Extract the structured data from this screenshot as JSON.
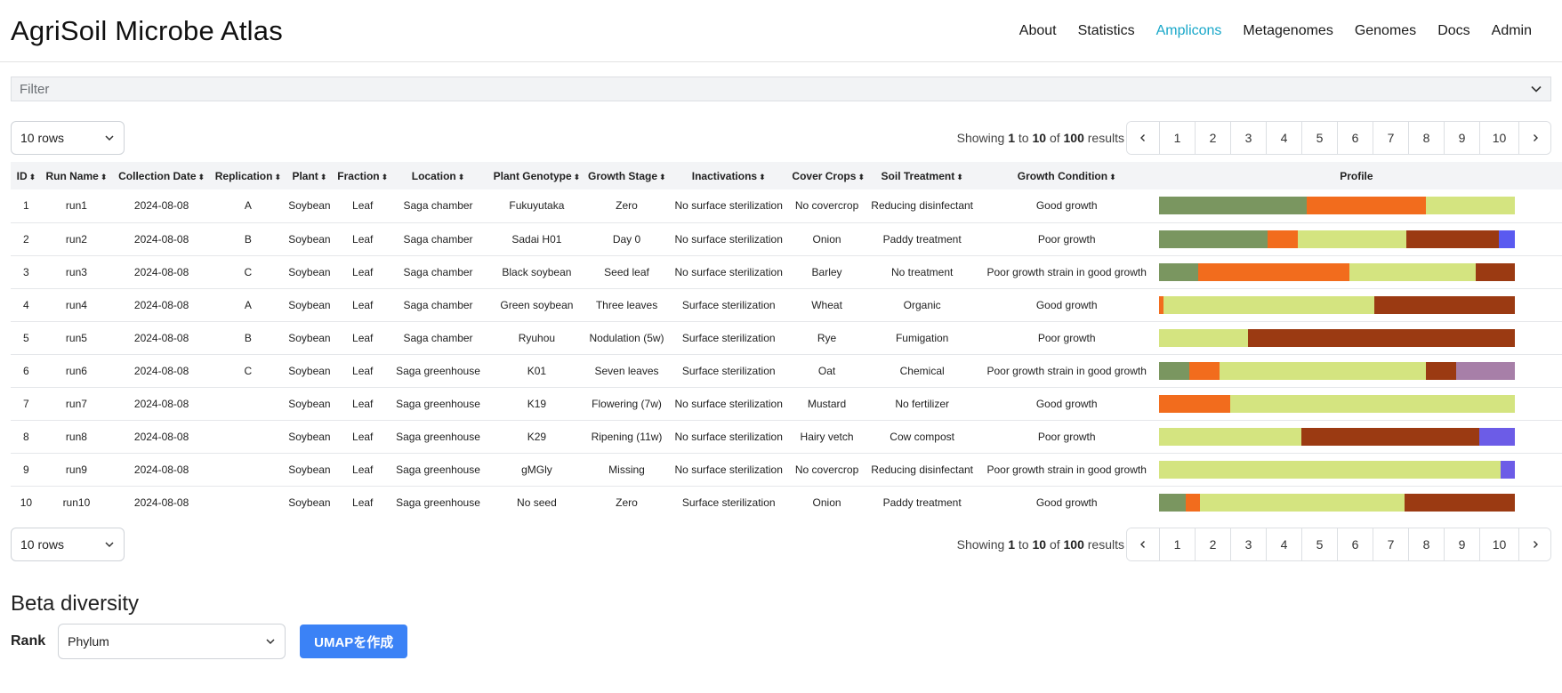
{
  "header": {
    "brand": "AgriSoil Microbe Atlas",
    "nav": [
      {
        "label": "About",
        "active": false
      },
      {
        "label": "Statistics",
        "active": false
      },
      {
        "label": "Amplicons",
        "active": true
      },
      {
        "label": "Metagenomes",
        "active": false
      },
      {
        "label": "Genomes",
        "active": false
      },
      {
        "label": "Docs",
        "active": false
      },
      {
        "label": "Admin",
        "active": false
      }
    ],
    "accent_color": "#18a7c9"
  },
  "filter": {
    "label": "Filter",
    "icon": "chevron-down-icon"
  },
  "pagination": {
    "rows_selected": "10 rows",
    "showing_prefix": "Showing",
    "from": "1",
    "to_word": "to",
    "to": "10",
    "of_word": "of",
    "total": "100",
    "results_word": "results",
    "pages": [
      "1",
      "2",
      "3",
      "4",
      "5",
      "6",
      "7",
      "8",
      "9",
      "10"
    ],
    "prev_icon": "chevron-left-icon",
    "next_icon": "chevron-right-icon"
  },
  "table": {
    "columns": [
      "ID",
      "Run Name",
      "Collection Date",
      "Replication",
      "Plant",
      "Fraction",
      "Location",
      "Plant Genotype",
      "Growth Stage",
      "Inactivations",
      "Cover Crops",
      "Soil Treatment",
      "Growth Condition",
      "Profile"
    ],
    "sortable": [
      true,
      true,
      true,
      true,
      true,
      true,
      true,
      true,
      true,
      true,
      true,
      true,
      true,
      false
    ],
    "profile_colors": {
      "c1": "#7a9660",
      "c2": "#f26c1d",
      "c3": "#d4e480",
      "c4": "#9b3a12",
      "c5": "#6c5ce7",
      "c6": "#a77fa8",
      "c7": "#5a5af0"
    },
    "rows": [
      {
        "id": "1",
        "run": "run1",
        "date": "2024-08-08",
        "rep": "A",
        "plant": "Soybean",
        "fraction": "Leaf",
        "location": "Saga chamber",
        "genotype": "Fukuyutaka",
        "stage": "Zero",
        "inact": "No surface sterilization",
        "cover": "No covercrop",
        "soil": "Reducing disinfectant",
        "growth": "Good growth",
        "profile": [
          {
            "color": "#7a9660",
            "frac": 0.415
          },
          {
            "color": "#f26c1d",
            "frac": 0.335
          },
          {
            "color": "#d4e480",
            "frac": 0.25
          }
        ]
      },
      {
        "id": "2",
        "run": "run2",
        "date": "2024-08-08",
        "rep": "B",
        "plant": "Soybean",
        "fraction": "Leaf",
        "location": "Saga chamber",
        "genotype": "Sadai H01",
        "stage": "Day 0",
        "inact": "No surface sterilization",
        "cover": "Onion",
        "soil": "Paddy treatment",
        "growth": "Poor growth",
        "profile": [
          {
            "color": "#7a9660",
            "frac": 0.305
          },
          {
            "color": "#f26c1d",
            "frac": 0.085
          },
          {
            "color": "#d4e480",
            "frac": 0.305
          },
          {
            "color": "#9b3a12",
            "frac": 0.26
          },
          {
            "color": "#5a5af0",
            "frac": 0.045
          }
        ]
      },
      {
        "id": "3",
        "run": "run3",
        "date": "2024-08-08",
        "rep": "C",
        "plant": "Soybean",
        "fraction": "Leaf",
        "location": "Saga chamber",
        "genotype": "Black soybean",
        "stage": "Seed leaf",
        "inact": "No surface sterilization",
        "cover": "Barley",
        "soil": "No treatment",
        "growth": "Poor growth strain in good growth",
        "profile": [
          {
            "color": "#7a9660",
            "frac": 0.11
          },
          {
            "color": "#f26c1d",
            "frac": 0.425
          },
          {
            "color": "#d4e480",
            "frac": 0.355
          },
          {
            "color": "#9b3a12",
            "frac": 0.11
          }
        ]
      },
      {
        "id": "4",
        "run": "run4",
        "date": "2024-08-08",
        "rep": "A",
        "plant": "Soybean",
        "fraction": "Leaf",
        "location": "Saga chamber",
        "genotype": "Green soybean",
        "stage": "Three leaves",
        "inact": "Surface sterilization",
        "cover": "Wheat",
        "soil": "Organic",
        "growth": "Good growth",
        "profile": [
          {
            "color": "#f26c1d",
            "frac": 0.012
          },
          {
            "color": "#d4e480",
            "frac": 0.593
          },
          {
            "color": "#9b3a12",
            "frac": 0.395
          }
        ]
      },
      {
        "id": "5",
        "run": "run5",
        "date": "2024-08-08",
        "rep": "B",
        "plant": "Soybean",
        "fraction": "Leaf",
        "location": "Saga chamber",
        "genotype": "Ryuhou",
        "stage": "Nodulation (5w)",
        "inact": "Surface sterilization",
        "cover": "Rye",
        "soil": "Fumigation",
        "growth": "Poor growth",
        "profile": [
          {
            "color": "#d4e480",
            "frac": 0.25
          },
          {
            "color": "#9b3a12",
            "frac": 0.75
          }
        ]
      },
      {
        "id": "6",
        "run": "run6",
        "date": "2024-08-08",
        "rep": "C",
        "plant": "Soybean",
        "fraction": "Leaf",
        "location": "Saga greenhouse",
        "genotype": "K01",
        "stage": "Seven leaves",
        "inact": "Surface sterilization",
        "cover": "Oat",
        "soil": "Chemical",
        "growth": "Poor growth strain in good growth",
        "profile": [
          {
            "color": "#7a9660",
            "frac": 0.085
          },
          {
            "color": "#f26c1d",
            "frac": 0.085
          },
          {
            "color": "#d4e480",
            "frac": 0.58
          },
          {
            "color": "#9b3a12",
            "frac": 0.085
          },
          {
            "color": "#a77fa8",
            "frac": 0.165
          }
        ]
      },
      {
        "id": "7",
        "run": "run7",
        "date": "2024-08-08",
        "rep": "",
        "plant": "Soybean",
        "fraction": "Leaf",
        "location": "Saga greenhouse",
        "genotype": "K19",
        "stage": "Flowering (7w)",
        "inact": "No surface sterilization",
        "cover": "Mustard",
        "soil": "No fertilizer",
        "growth": "Good growth",
        "profile": [
          {
            "color": "#f26c1d",
            "frac": 0.2
          },
          {
            "color": "#d4e480",
            "frac": 0.8
          }
        ]
      },
      {
        "id": "8",
        "run": "run8",
        "date": "2024-08-08",
        "rep": "",
        "plant": "Soybean",
        "fraction": "Leaf",
        "location": "Saga greenhouse",
        "genotype": "K29",
        "stage": "Ripening (11w)",
        "inact": "No surface sterilization",
        "cover": "Hairy vetch",
        "soil": "Cow compost",
        "growth": "Poor growth",
        "profile": [
          {
            "color": "#d4e480",
            "frac": 0.4
          },
          {
            "color": "#9b3a12",
            "frac": 0.5
          },
          {
            "color": "#6c5ce7",
            "frac": 0.1
          }
        ]
      },
      {
        "id": "9",
        "run": "run9",
        "date": "2024-08-08",
        "rep": "",
        "plant": "Soybean",
        "fraction": "Leaf",
        "location": "Saga greenhouse",
        "genotype": "gMGly",
        "stage": "Missing",
        "inact": "No surface sterilization",
        "cover": "No covercrop",
        "soil": "Reducing disinfectant",
        "growth": "Poor growth strain in good growth",
        "profile": [
          {
            "color": "#d4e480",
            "frac": 0.96
          },
          {
            "color": "#6c5ce7",
            "frac": 0.04
          }
        ]
      },
      {
        "id": "10",
        "run": "run10",
        "date": "2024-08-08",
        "rep": "",
        "plant": "Soybean",
        "fraction": "Leaf",
        "location": "Saga greenhouse",
        "genotype": "No seed",
        "stage": "Zero",
        "inact": "Surface sterilization",
        "cover": "Onion",
        "soil": "Paddy treatment",
        "growth": "Good growth",
        "profile": [
          {
            "color": "#7a9660",
            "frac": 0.075
          },
          {
            "color": "#f26c1d",
            "frac": 0.04
          },
          {
            "color": "#d4e480",
            "frac": 0.575
          },
          {
            "color": "#9b3a12",
            "frac": 0.31
          }
        ]
      }
    ]
  },
  "beta": {
    "title": "Beta diversity",
    "rank_label": "Rank",
    "rank_value": "Phylum",
    "button_label": "UMAPを作成"
  }
}
